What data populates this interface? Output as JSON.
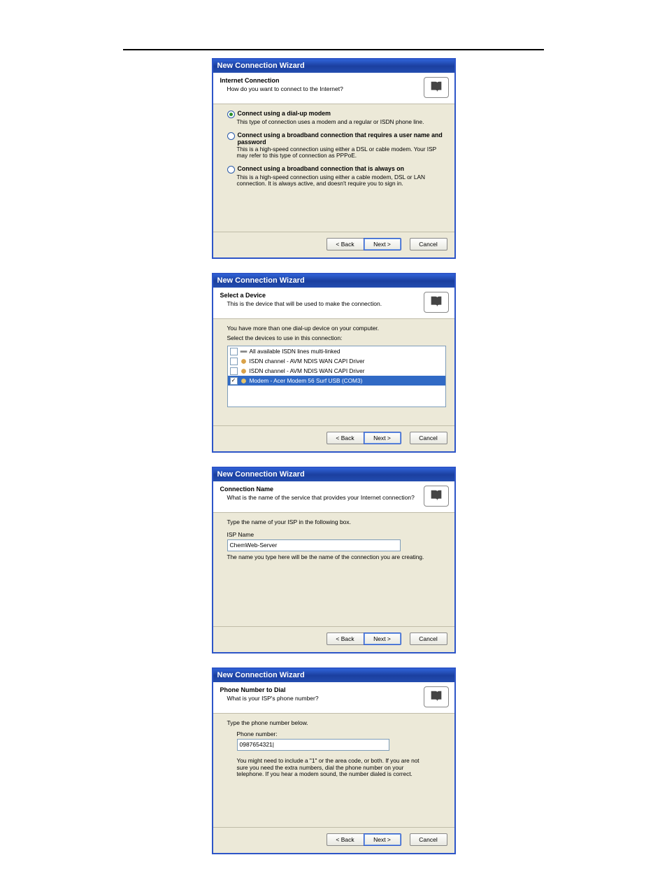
{
  "wizards": {
    "w1": {
      "title": "New Connection Wizard",
      "header_title": "Internet Connection",
      "header_sub": "How do you want to connect to the Internet?",
      "opt1_label": "Connect using a dial-up modem",
      "opt1_desc": "This type of connection uses a modem and a regular or ISDN phone line.",
      "opt2_label": "Connect using a broadband connection that requires a user name and password",
      "opt2_desc": "This is a high-speed connection using either a DSL or cable modem. Your ISP may refer to this type of connection as PPPoE.",
      "opt3_label": "Connect using a broadband connection that is always on",
      "opt3_desc": "This is a high-speed connection using either a cable modem, DSL or LAN connection. It is always active, and doesn't require you to sign in.",
      "back": "< Back",
      "next": "Next >",
      "cancel": "Cancel"
    },
    "w2": {
      "title": "New Connection Wizard",
      "header_title": "Select a Device",
      "header_sub": "This is the device that will be used to make the connection.",
      "inst1": "You have more than one dial-up device on your computer.",
      "inst2": "Select the devices to use in this connection:",
      "items": {
        "i0": "All available ISDN lines multi-linked",
        "i1": "ISDN  channel - AVM NDIS WAN CAPI Driver",
        "i2": "ISDN  channel - AVM NDIS WAN CAPI Driver",
        "i3": "Modem - Acer Modem 56 Surf USB (COM3)"
      },
      "back": "< Back",
      "next": "Next >",
      "cancel": "Cancel"
    },
    "w3": {
      "title": "New Connection Wizard",
      "header_title": "Connection Name",
      "header_sub": "What is the name of the service that provides your Internet connection?",
      "inst": "Type the name of your ISP in the following box.",
      "field_label": "ISP Name",
      "field_value": "ChemWeb-Server",
      "hint": "The name you type here will be the name of the connection you are creating.",
      "back": "< Back",
      "next": "Next >",
      "cancel": "Cancel"
    },
    "w4": {
      "title": "New Connection Wizard",
      "header_title": "Phone Number to Dial",
      "header_sub": "What is your ISP's phone number?",
      "inst": "Type the phone number below.",
      "field_label": "Phone number:",
      "field_value": "0987654321|",
      "hint": "You might need to include a \"1\" or the area code, or both. If you are not sure you need the extra numbers, dial the phone number on your telephone. If you hear a modem sound, the number dialed is correct.",
      "back": "< Back",
      "next": "Next >",
      "cancel": "Cancel"
    }
  }
}
